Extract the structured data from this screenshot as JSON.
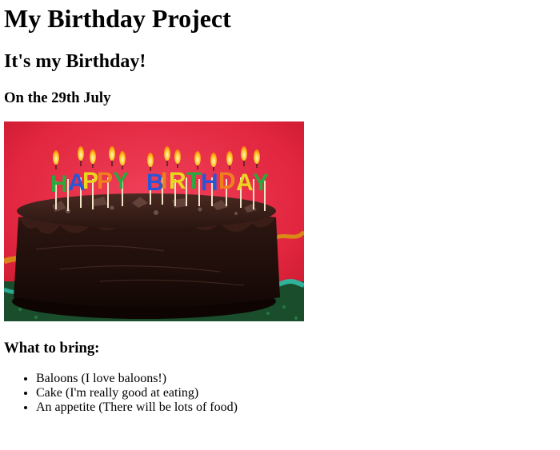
{
  "page": {
    "title": "My Birthday Project",
    "subtitle": "It's my Birthday!",
    "date_line": "On the 29th July",
    "image": {
      "description_icon": "birthday-cake-photo",
      "candle_text": "HAPPY BIRTHDAY"
    },
    "bring_heading": "What to bring:",
    "bring_items": [
      "Baloons (I love baloons!)",
      "Cake (I'm really good at eating)",
      "An appetite (There will be lots of food)"
    ]
  }
}
